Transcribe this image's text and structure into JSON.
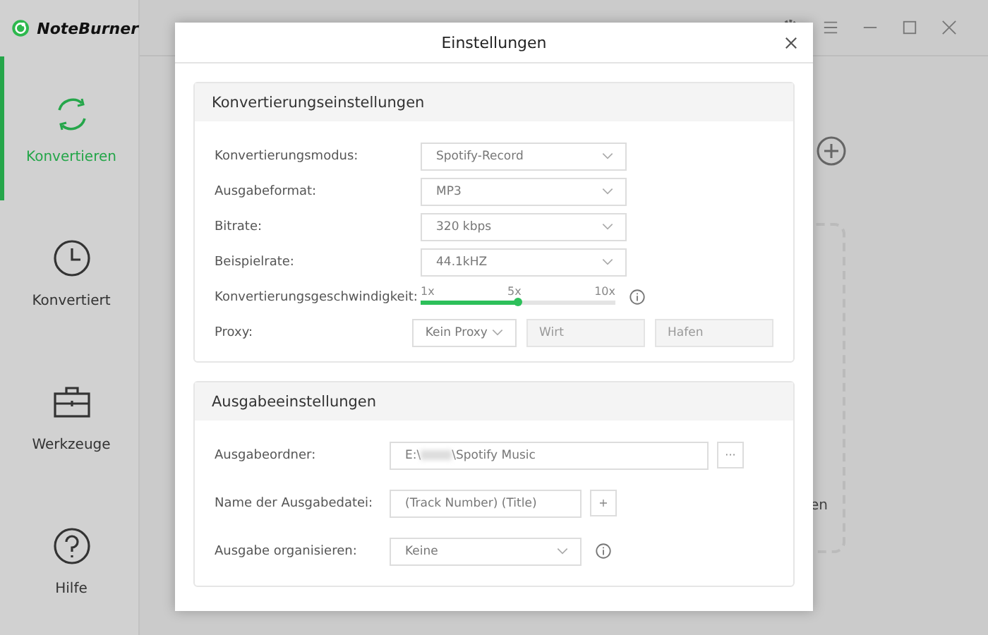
{
  "app": {
    "name": "NoteBurner"
  },
  "sidebar": {
    "items": [
      {
        "label": "Konvertieren",
        "kind": "convert",
        "selected": true
      },
      {
        "label": "Konvertiert",
        "kind": "clock",
        "selected": false
      },
      {
        "label": "Werkzeuge",
        "kind": "toolbox",
        "selected": false
      },
      {
        "label": "Hilfe",
        "kind": "help",
        "selected": false
      }
    ]
  },
  "background": {
    "partial_text": "en"
  },
  "dialog": {
    "title": "Einstellungen",
    "conversion": {
      "title": "Konvertierungseinstellungen",
      "selects": [
        {
          "label": "Konvertierungsmodus:",
          "value": "Spotify-Record"
        },
        {
          "label": "Ausgabeformat:",
          "value": "MP3"
        },
        {
          "label": "Bitrate:",
          "value": "320 kbps"
        },
        {
          "label": "Beispielrate:",
          "value": "44.1kHZ"
        }
      ],
      "speed": {
        "label": "Konvertierungsgeschwindigkeit:",
        "ticks": [
          "1x",
          "5x",
          "10x"
        ],
        "level": 0.5
      },
      "proxy": {
        "label": "Proxy:",
        "value": "Kein Proxy",
        "host_placeholder": "Wirt",
        "port_placeholder": "Hafen"
      }
    },
    "output": {
      "title": "Ausgabeeinstellungen",
      "folder": {
        "label": "Ausgabeordner:",
        "value_start": "E:\\",
        "value_end": "\\Spotify Music",
        "button": "···"
      },
      "filename": {
        "label": "Name der Ausgabedatei:",
        "value": "(Track Number) (Title)",
        "button": "+"
      },
      "organize": {
        "label": "Ausgabe organisieren:",
        "value": "Keine"
      }
    }
  }
}
